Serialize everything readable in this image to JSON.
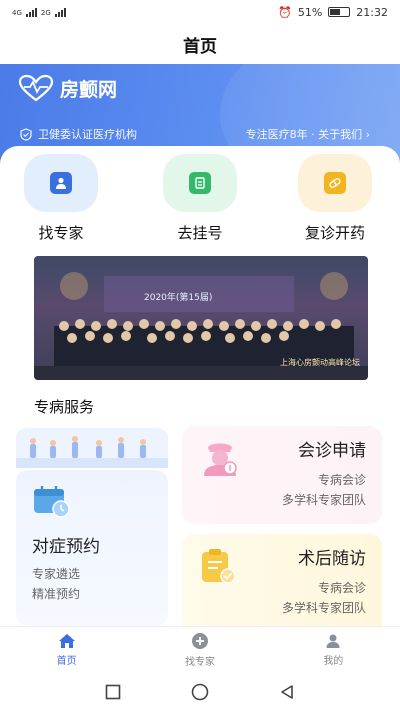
{
  "status_bar": {
    "signal_left": "4G",
    "signal_left2": "2G",
    "alarm": "⏰",
    "battery": "51%",
    "time": "21:32"
  },
  "header": {
    "title": "首页"
  },
  "banner": {
    "brand": "房颤网",
    "certification": "卫健委认证医疗机构",
    "tagline": "专注医疗8年 · 关于我们 ›"
  },
  "quick_actions": [
    {
      "label": "找专家",
      "icon": "doctor-icon",
      "bg": "#e3eefc",
      "icon_color": "#3a6fe0"
    },
    {
      "label": "去挂号",
      "icon": "register-icon",
      "bg": "#e3f6ea",
      "icon_color": "#34b86a"
    },
    {
      "label": "复诊开药",
      "icon": "pill-icon",
      "bg": "#fdf2d9",
      "icon_color": "#f2b522"
    }
  ],
  "photo": {
    "caption": "2020年(第15届)",
    "caption2": "上海心房颤动高峰论坛"
  },
  "section": {
    "title": "专病服务"
  },
  "cards": {
    "symptom": {
      "title": "对症预约",
      "line1": "专家遴选",
      "line2": "精准预约"
    },
    "consult": {
      "title": "会诊申请",
      "line1": "专病会诊",
      "line2": "多学科专家团队"
    },
    "followup": {
      "title": "术后随访",
      "line1": "专病会诊",
      "line2": "多学科专家团队"
    }
  },
  "tabbar": [
    {
      "label": "首页",
      "icon": "home-icon",
      "active": true
    },
    {
      "label": "找专家",
      "icon": "plus-circle-icon",
      "active": false
    },
    {
      "label": "我的",
      "icon": "user-icon",
      "active": false
    }
  ],
  "colors": {
    "primary": "#3a6fe0",
    "banner": "#5d8ef0"
  }
}
